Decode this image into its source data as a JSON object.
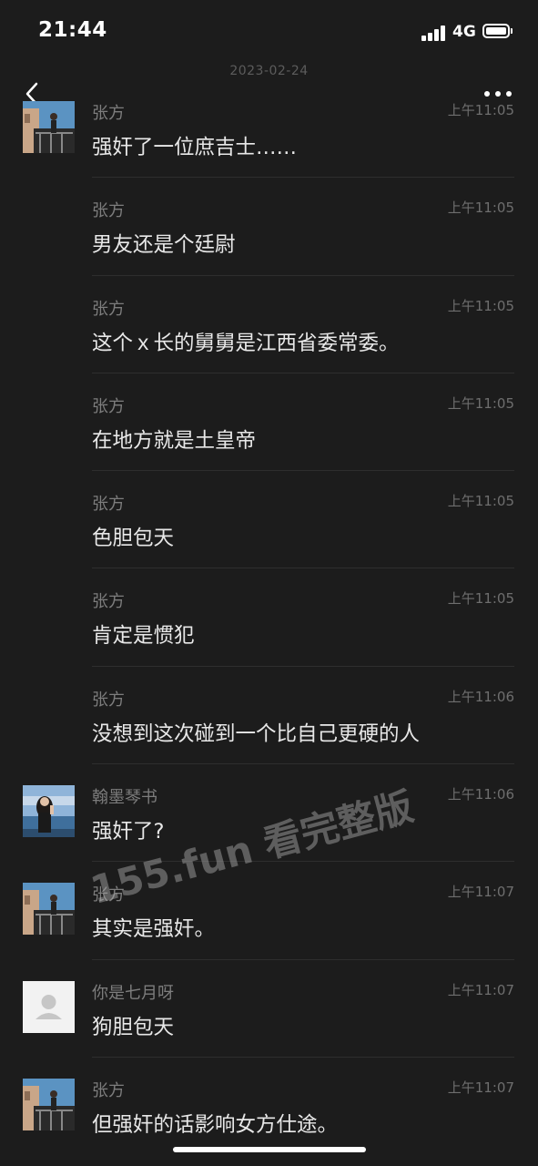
{
  "status_bar": {
    "time": "21:44",
    "network": "4G"
  },
  "date_separator": "2023-02-24",
  "colors": {
    "background": "#1c1c1c",
    "text": "#e8e8e8",
    "meta": "#7d7d7d"
  },
  "messages": [
    {
      "sender": "张方",
      "time": "上午11:05",
      "text": "强奸了一位庶吉士……",
      "avatar": "photo-avatar-zhangfang"
    },
    {
      "sender": "张方",
      "time": "上午11:05",
      "text": "男友还是个廷尉"
    },
    {
      "sender": "张方",
      "time": "上午11:05",
      "text": "这个ｘ长的舅舅是江西省委常委。"
    },
    {
      "sender": "张方",
      "time": "上午11:05",
      "text": "在地方就是土皇帝"
    },
    {
      "sender": "张方",
      "time": "上午11:05",
      "text": "色胆包天"
    },
    {
      "sender": "张方",
      "time": "上午11:05",
      "text": "肯定是惯犯"
    },
    {
      "sender": "张方",
      "time": "上午11:06",
      "text": "没想到这次碰到一个比自己更硬的人"
    },
    {
      "sender": "翰墨琴书",
      "time": "上午11:06",
      "text": "强奸了?",
      "avatar": "photo-avatar-hanmoqinshu"
    },
    {
      "sender": "张方",
      "time": "上午11:07",
      "text": "其实是强奸。",
      "avatar": "photo-avatar-zhangfang"
    },
    {
      "sender": "你是七月呀",
      "time": "上午11:07",
      "text": "狗胆包天",
      "avatar": "default-avatar"
    },
    {
      "sender": "张方",
      "time": "上午11:07",
      "text": "但强奸的话影响女方仕途。",
      "avatar": "photo-avatar-zhangfang"
    }
  ],
  "watermark": "155.fun 看完整版"
}
